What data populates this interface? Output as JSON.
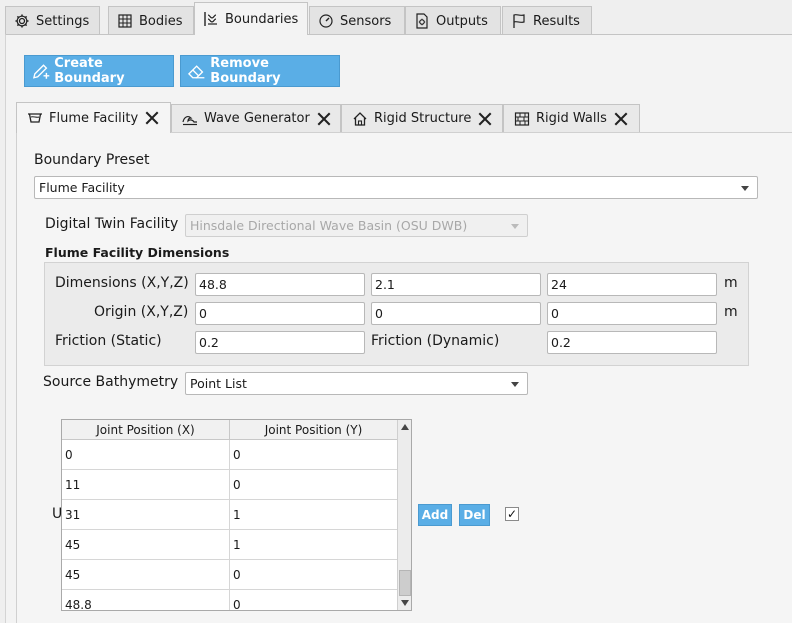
{
  "top_tabs": [
    {
      "label": "Settings",
      "icon": "gear-icon"
    },
    {
      "label": "Bodies",
      "icon": "cube-grid-icon"
    },
    {
      "label": "Boundaries",
      "icon": "wave-boundary-icon",
      "active": true
    },
    {
      "label": "Sensors",
      "icon": "gauge-icon"
    },
    {
      "label": "Outputs",
      "icon": "document-gear-icon"
    },
    {
      "label": "Results",
      "icon": "flag-icon"
    }
  ],
  "actions": {
    "create_label": "Create Boundary",
    "remove_label": "Remove Boundary"
  },
  "boundary_tabs": [
    {
      "label": "Flume Facility",
      "active": true
    },
    {
      "label": "Wave Generator"
    },
    {
      "label": "Rigid Structure"
    },
    {
      "label": "Rigid Walls"
    }
  ],
  "form": {
    "preset_label": "Boundary Preset",
    "preset_value": "Flume Facility",
    "twin_label": "Digital Twin Facility",
    "twin_value": "Hinsdale Directional Wave Basin (OSU DWB)",
    "dims_title": "Flume Facility Dimensions",
    "dims_label": "Dimensions (X,Y,Z)",
    "dims": [
      "48.8",
      "2.1",
      "24"
    ],
    "dims_unit": "m",
    "origin_label": "Origin (X,Y,Z)",
    "origin": [
      "0",
      "0",
      "0"
    ],
    "origin_unit": "m",
    "friction_static_label": "Friction (Static)",
    "friction_static": "0.2",
    "friction_dynamic_label": "Friction (Dynamic)",
    "friction_dynamic": "0.2",
    "bathy_label": "Source Bathymetry",
    "bathy_value": "Point List",
    "cut_label": "U"
  },
  "table": {
    "headers": [
      "Joint Position (X)",
      "Joint Position (Y)"
    ],
    "rows": [
      [
        "0",
        "0"
      ],
      [
        "11",
        "0"
      ],
      [
        "31",
        "1"
      ],
      [
        "45",
        "1"
      ],
      [
        "45",
        "0"
      ],
      [
        "48.8",
        "0"
      ]
    ]
  },
  "table_actions": {
    "add_label": "Add",
    "del_label": "Del",
    "checkbox_mark": "✓"
  }
}
